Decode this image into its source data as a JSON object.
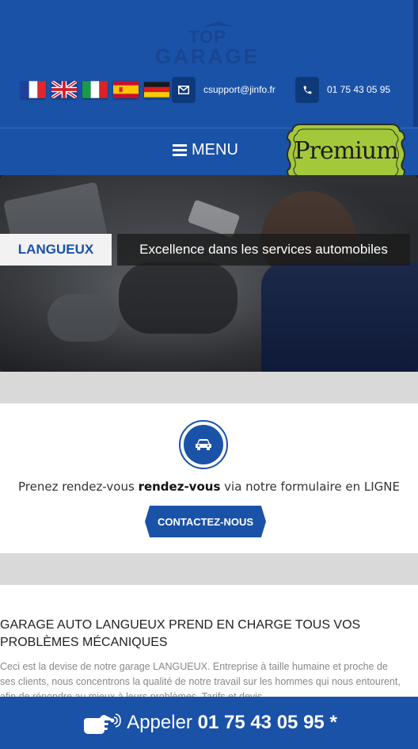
{
  "brand": {
    "logo_line1": "TOP",
    "logo_line2": "GARAGE"
  },
  "languages": [
    "fr",
    "en",
    "it",
    "es",
    "de"
  ],
  "contact": {
    "email": "csupport@jinfo.fr",
    "phone": "01 75 43 05 95"
  },
  "nav": {
    "menu_label": "MENU"
  },
  "badge": {
    "label": "Premium"
  },
  "hero": {
    "location": "LANGUEUX",
    "slogan": "Excellence dans les services automobiles"
  },
  "cta": {
    "text_before": "Prenez rendez-vous ",
    "text_bold": "rendez-vous",
    "text_after": " via notre formulaire en LIGNE",
    "button_label": "CONTACTEZ-NOUS",
    "icon": "car-icon"
  },
  "article": {
    "title": "GARAGE AUTO LANGUEUX PREND EN CHARGE TOUS VOS PROBLÈMES MÉCANIQUES",
    "body": "Ceci est la devise de notre garage LANGUEUX. Entreprise à taille humaine et proche de ses clients, nous concentrons la qualité de notre travail sur les hommes qui nous entourent, afin de répondre au mieux à leurs problèmes. Tarifs et devis"
  },
  "call_bar": {
    "label": "Appeler",
    "number": "01 75 43 05 95",
    "suffix": "*"
  },
  "colors": {
    "primary": "#1a52a8",
    "dark_blue": "#0f3a7a",
    "band_gray": "#d9d9d9",
    "premium_green": "#a3c93a"
  }
}
